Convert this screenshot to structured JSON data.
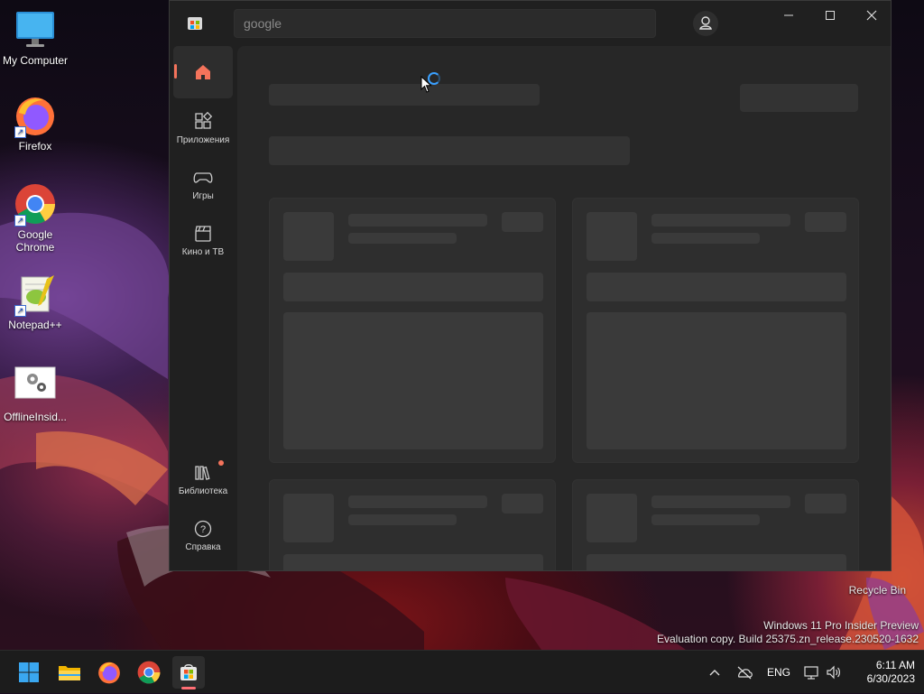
{
  "desktop": {
    "icons": [
      {
        "label": "My Computer",
        "icon": "monitor-icon"
      },
      {
        "label": "Firefox",
        "icon": "firefox-icon"
      },
      {
        "label": "Google Chrome",
        "icon": "chrome-icon"
      },
      {
        "label": "Notepad++",
        "icon": "notepad-plus-plus-icon"
      },
      {
        "label": "OfflineInsid...",
        "icon": "gear-app-icon"
      }
    ],
    "recycle_bin": "Recycle Bin",
    "watermark": {
      "line1": "Windows 11 Pro Insider Preview",
      "line2": "Evaluation copy. Build 25375.zn_release.230520-1632"
    }
  },
  "store_window": {
    "search_text": "google",
    "nav": [
      {
        "label": "",
        "icon": "home-icon",
        "active": true
      },
      {
        "label": "Приложения",
        "icon": "apps-icon"
      },
      {
        "label": "Игры",
        "icon": "gamepad-icon"
      },
      {
        "label": "Кино и ТВ",
        "icon": "clapperboard-icon"
      }
    ],
    "nav_bottom": [
      {
        "label": "Библиотека",
        "icon": "library-icon",
        "badge": true
      },
      {
        "label": "Справка",
        "icon": "help-icon"
      }
    ],
    "state": "loading",
    "accent": "#f4735b"
  },
  "taskbar": {
    "apps": [
      "start-icon",
      "file-explorer-icon",
      "firefox-icon",
      "chrome-icon",
      "store-icon"
    ],
    "lang": "ENG",
    "time": "6:11 AM",
    "date": "6/30/2023"
  }
}
